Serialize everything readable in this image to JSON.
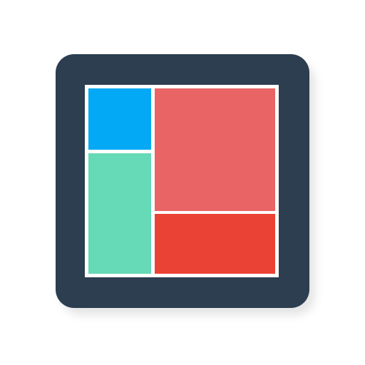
{
  "icon": {
    "name": "layout-grid-icon",
    "colors": {
      "tile": "#2c3e50",
      "frame": "#ffffff",
      "block_top_left": "#03a9f4",
      "block_bottom_left": "#66d9b6",
      "block_top_right": "#e96565",
      "block_bottom_right": "#ea4335"
    }
  }
}
